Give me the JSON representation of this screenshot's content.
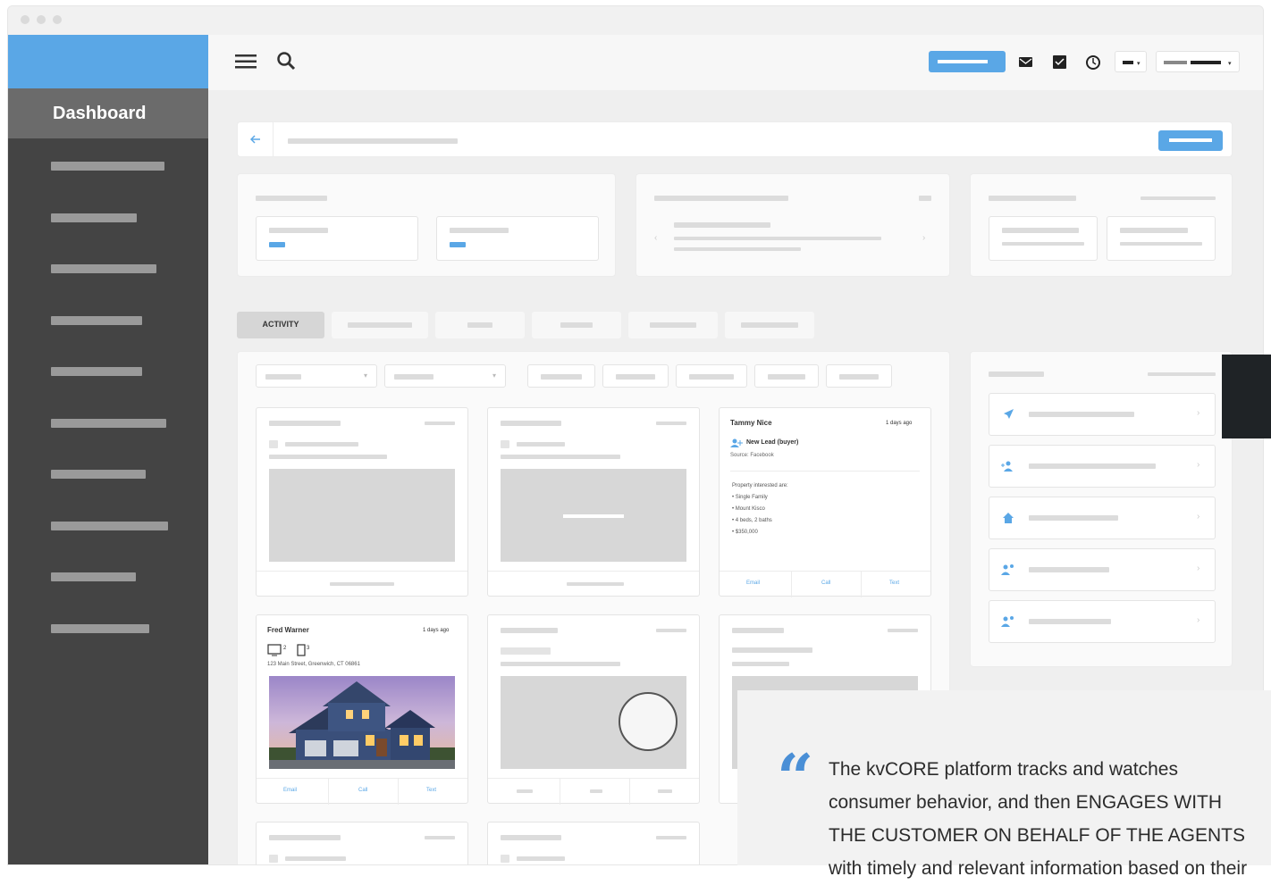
{
  "sidebar": {
    "title": "Dashboard",
    "item_count": 10
  },
  "activity_tab": "ACTIVITY",
  "cards": {
    "tammy": {
      "name": "Tammy Nice",
      "time": "1 days ago",
      "lead_type": "New Lead (buyer)",
      "source": "Source: Facebook",
      "interest_heading": "Property interested are:",
      "interests": [
        "Single Family",
        "Mount Kisco",
        "4 beds, 2 baths",
        "$350,000"
      ],
      "actions": [
        "Email",
        "Call",
        "Text"
      ]
    },
    "fred": {
      "name": "Fred Warner",
      "time": "1 days ago",
      "address": "123 Main Street, Greenwich, CT 06861",
      "actions": [
        "Email",
        "Call",
        "Text"
      ]
    }
  },
  "quote": {
    "mark": "“",
    "text": "The kvCORE platform tracks and watches consumer behavior, and then ENGAGES WITH THE CUSTOMER ON BEHALF OF THE AGENTS with timely and relevant information based on their"
  },
  "colors": {
    "accent": "#5aa7e6",
    "sidebar": "#444444",
    "quote_mark": "#4a8fd6"
  },
  "icons": [
    "menu-icon",
    "search-icon",
    "mail-icon",
    "checkbox-icon",
    "history-icon",
    "back-arrow-icon",
    "rocket-icon",
    "user-add-icon",
    "home-icon",
    "users-icon",
    "house-photo"
  ]
}
